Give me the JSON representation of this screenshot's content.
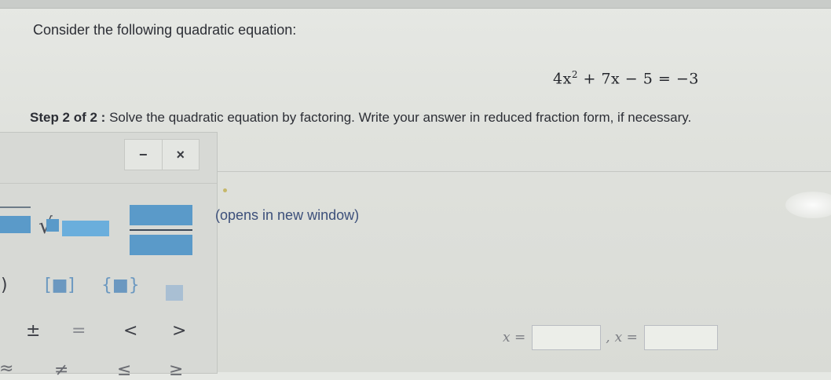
{
  "question": {
    "prompt": "Consider the following quadratic equation:",
    "equation_base": "4x",
    "equation_exponent": "2",
    "equation_rest": " + 7x − 5 = −3",
    "step_label": "Step 2 of 2 :",
    "step_instruction": "Solve the quadratic equation by factoring. Write your answer in reduced fraction form, if necessary."
  },
  "palette": {
    "minimize_label": "−",
    "close_label": "×",
    "sqrt_symbol": "√",
    "paren_label": ")",
    "bracket_label": "[■]",
    "brace_label": "{■}",
    "plusminus_label": "±",
    "equals_label": "=",
    "less_label": "<",
    "greater_label": ">",
    "bottom_row": [
      "≈",
      "≠",
      "≤",
      "≥"
    ]
  },
  "link": {
    "text": "(opens in new window)"
  },
  "answers": {
    "label_1": "x =",
    "separator": ",",
    "label_2": "x =",
    "value_1": "",
    "value_2": ""
  },
  "colors": {
    "template_blue": "#5a9ac9",
    "background": "#dfe1dc"
  }
}
